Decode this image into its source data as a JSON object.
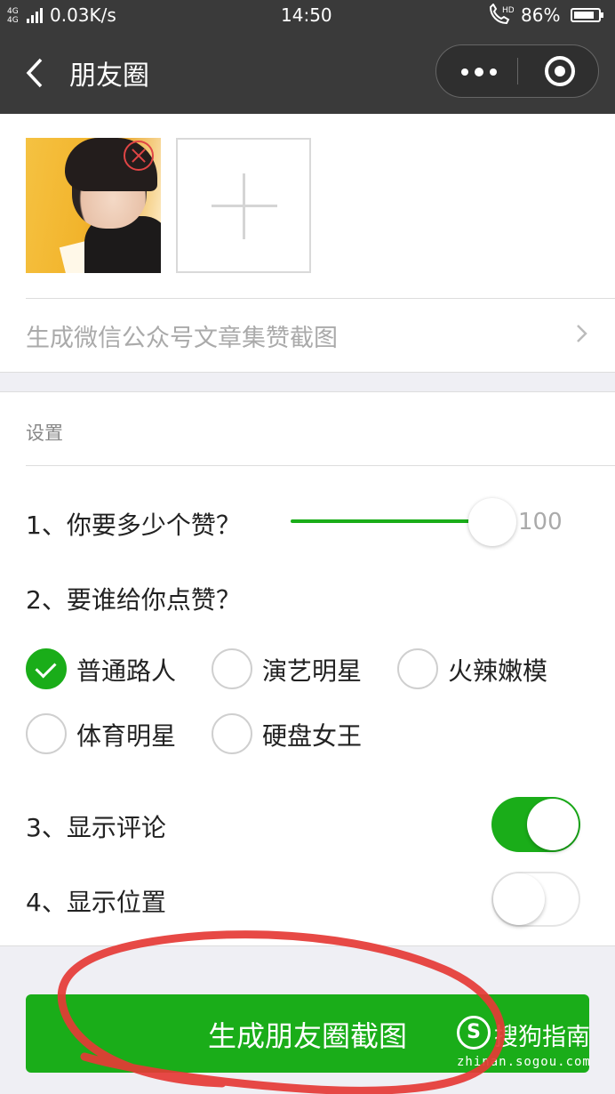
{
  "status_bar": {
    "network": "4G 4G",
    "speed": "0.03K/s",
    "time": "14:50",
    "call_icon": "hd-call-icon",
    "battery": "86%",
    "battery_level": 0.86
  },
  "navbar": {
    "title": "朋友圈",
    "back_icon": "chevron-left-icon",
    "more_icon": "more-dots-icon",
    "close_icon": "target-circle-icon"
  },
  "photos": {
    "add_icon": "plus-icon",
    "delete_icon": "close-circle-icon",
    "article_link": "生成微信公众号文章集赞截图"
  },
  "settings": {
    "title": "设置",
    "q1": "1、你要多少个赞？",
    "likes_value": "100",
    "likes_fraction": 1.0,
    "q2": "2、要谁给你点赞？",
    "options": [
      {
        "label": "普通路人",
        "checked": true
      },
      {
        "label": "演艺明星",
        "checked": false
      },
      {
        "label": "火辣嫩模",
        "checked": false
      },
      {
        "label": "体育明星",
        "checked": false
      },
      {
        "label": "硬盘女王",
        "checked": false
      }
    ],
    "q3": "3、显示评论",
    "show_comments": true,
    "q4": "4、显示位置",
    "show_location": false
  },
  "primary_button": "生成朋友圈截图",
  "watermark": {
    "icon": "S",
    "text": "搜狗指南",
    "url": "zhinan.sogou.com"
  },
  "colors": {
    "accent": "#1aad19",
    "navbar": "#3a3a3a",
    "annotation": "#e53935"
  }
}
